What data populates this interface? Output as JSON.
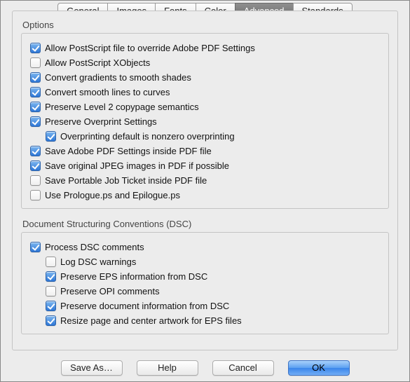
{
  "tabs": {
    "general": "General",
    "images": "Images",
    "fonts": "Fonts",
    "color": "Color",
    "advanced": "Advanced",
    "standards": "Standards",
    "selected": "advanced"
  },
  "options_group": {
    "title": "Options",
    "allow_ps_override": {
      "label": "Allow PostScript file to override Adobe PDF Settings",
      "checked": true
    },
    "allow_ps_xobjects": {
      "label": "Allow PostScript XObjects",
      "checked": false
    },
    "convert_gradients": {
      "label": "Convert gradients to smooth shades",
      "checked": true
    },
    "convert_smooth_lines": {
      "label": "Convert smooth lines to curves",
      "checked": true
    },
    "preserve_level2": {
      "label": "Preserve Level 2 copypage semantics",
      "checked": true
    },
    "preserve_overprint": {
      "label": "Preserve Overprint Settings",
      "checked": true
    },
    "overprint_default": {
      "label": "Overprinting default is nonzero overprinting",
      "checked": true
    },
    "save_pdf_settings": {
      "label": "Save Adobe PDF Settings inside PDF file",
      "checked": true
    },
    "save_original_jpeg": {
      "label": "Save original JPEG images in PDF if possible",
      "checked": true
    },
    "save_portable_job_ticket": {
      "label": "Save Portable Job Ticket inside PDF file",
      "checked": false
    },
    "use_prologue_epilogue": {
      "label": "Use Prologue.ps and Epilogue.ps",
      "checked": false
    }
  },
  "dsc_group": {
    "title": "Document Structuring Conventions (DSC)",
    "process_dsc": {
      "label": "Process DSC comments",
      "checked": true
    },
    "log_dsc_warnings": {
      "label": "Log DSC warnings",
      "checked": false
    },
    "preserve_eps_info": {
      "label": "Preserve EPS information from DSC",
      "checked": true
    },
    "preserve_opi_comments": {
      "label": "Preserve OPI comments",
      "checked": false
    },
    "preserve_doc_info": {
      "label": "Preserve document information from DSC",
      "checked": true
    },
    "resize_page_center": {
      "label": "Resize page and center artwork for EPS files",
      "checked": true
    }
  },
  "buttons": {
    "save_as": "Save As…",
    "help": "Help",
    "cancel": "Cancel",
    "ok": "OK"
  }
}
